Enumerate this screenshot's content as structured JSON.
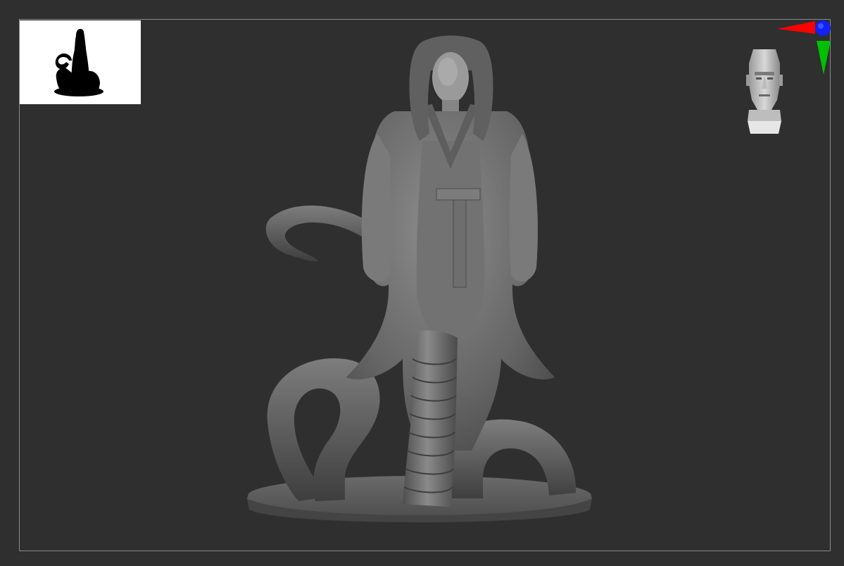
{
  "viewport": {
    "background": "#2f2f2f",
    "frame_color": "#8a8a8a"
  },
  "silhouette_preview": {
    "background": "#ffffff",
    "fill": "#000000",
    "icon": "figure-silhouette-icon"
  },
  "axis_gizmo": {
    "x_color": "#ff0000",
    "y_color": "#00c000",
    "z_color": "#0000ff",
    "icon": "axis-gizmo-icon"
  },
  "orientation_head": {
    "icon": "head-orientation-icon"
  },
  "model": {
    "icon": "sculpted-figure-model",
    "base_color": "#6a6a6a"
  }
}
